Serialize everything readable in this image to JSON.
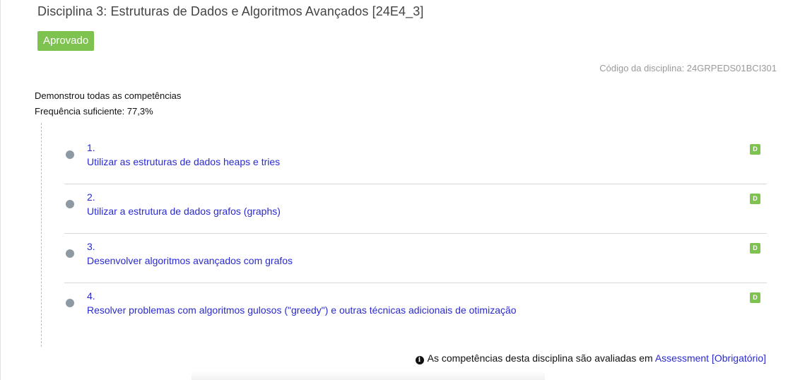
{
  "course": {
    "title": "Disciplina 3: Estruturas de Dados e Algoritmos Avançados [24E4_3]",
    "status_badge": "Aprovado",
    "code_label": "Código da disciplina: 24GRPEDS01BCI301"
  },
  "summary": {
    "competencies_text": "Demonstrou todas as competências",
    "attendance_text": "Frequência suficiente: 77,3%"
  },
  "competencies": [
    {
      "number": "1.",
      "text": "Utilizar as estruturas de dados heaps e tries",
      "grade": "D"
    },
    {
      "number": "2.",
      "text": "Utilizar a estrutura de dados grafos (graphs)",
      "grade": "D"
    },
    {
      "number": "3.",
      "text": "Desenvolver algoritmos avançados com grafos",
      "grade": "D"
    },
    {
      "number": "4.",
      "text": "Resolver problemas com algoritmos gulosos (\"greedy\") e outras técnicas adicionais de otimização",
      "grade": "D"
    }
  ],
  "footer": {
    "info_icon": "info-circle-icon",
    "text": "As competências desta disciplina são avaliadas em",
    "link_text": "Assessment [Obrigatório]"
  },
  "colors": {
    "approved_green": "#7ec34f",
    "link_blue": "#2a2ad0",
    "dot_gray": "#8d9aa3"
  }
}
